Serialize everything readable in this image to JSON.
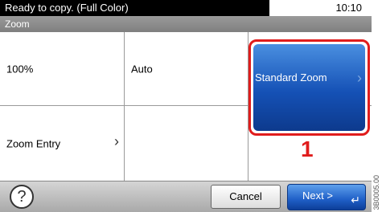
{
  "status": {
    "message": "Ready to copy. (Full Color)",
    "time": "10:10"
  },
  "screen_title": "Zoom",
  "options": {
    "percent": "100%",
    "auto": "Auto",
    "standard_zoom": "Standard Zoom",
    "zoom_entry": "Zoom Entry"
  },
  "callout": "1",
  "footer": {
    "help": "?",
    "cancel": "Cancel",
    "next": "Next >"
  },
  "figure_code": "3B0005.00",
  "colors": {
    "accent_blue": "#1551b6",
    "highlight_red": "#e01c1c"
  }
}
